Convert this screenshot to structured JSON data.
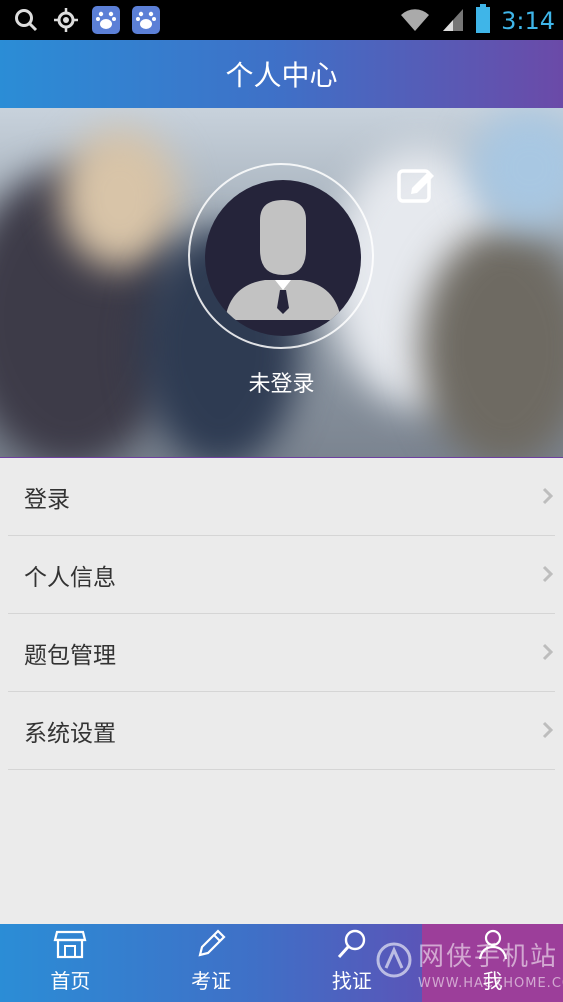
{
  "status_bar": {
    "time": "3:14",
    "icons": [
      "search-icon",
      "gps-icon",
      "baidu-icon",
      "baidu-icon",
      "wifi-icon",
      "signal-icon",
      "battery-icon"
    ]
  },
  "header": {
    "title": "个人中心"
  },
  "profile": {
    "username": "未登录",
    "edit_icon": "edit-icon"
  },
  "menu": {
    "items": [
      {
        "label": "登录"
      },
      {
        "label": "个人信息"
      },
      {
        "label": "题包管理"
      },
      {
        "label": "系统设置"
      }
    ]
  },
  "tabs": [
    {
      "label": "首页",
      "icon": "store-icon",
      "active": false
    },
    {
      "label": "考证",
      "icon": "pencil-icon",
      "active": false
    },
    {
      "label": "找证",
      "icon": "search-icon",
      "active": false
    },
    {
      "label": "我",
      "icon": "user-icon",
      "active": true
    }
  ],
  "watermark": {
    "title": "网侠手机站",
    "url": "WWW.HACKHOME.COM"
  },
  "colors": {
    "accent_blue": "#2b8dd6",
    "accent_purple": "#6b4aa8",
    "active_tab": "#9c3e9a",
    "status_time": "#3fb5e8"
  }
}
